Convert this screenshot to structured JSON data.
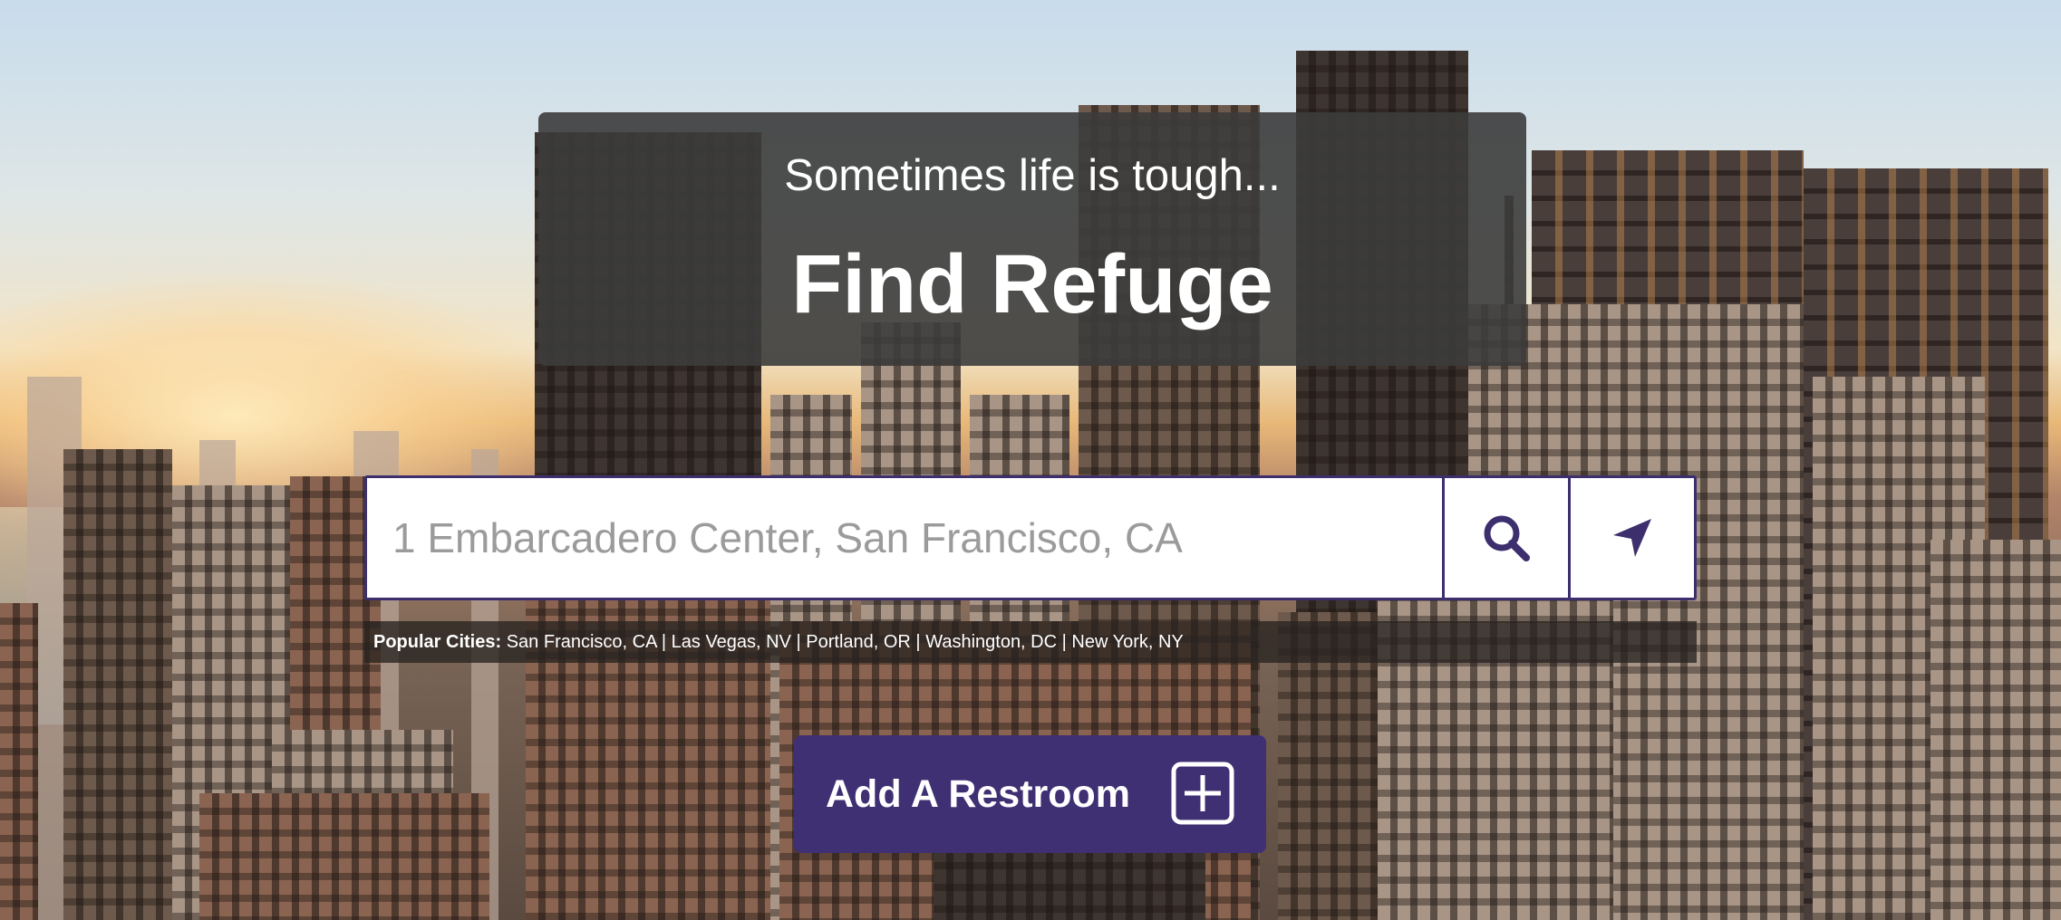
{
  "hero": {
    "subtitle": "Sometimes life is tough...",
    "title": "Find Refuge"
  },
  "search": {
    "placeholder": "1 Embarcadero Center, San Francisco, CA",
    "search_icon": "search-icon",
    "locate_icon": "location-arrow-icon"
  },
  "popular_cities": {
    "label": "Popular Cities:",
    "cities": [
      "San Francisco, CA",
      "Las Vegas, NV",
      "Portland, OR",
      "Washington, DC",
      "New York, NY"
    ],
    "separator": " | "
  },
  "add_restroom": {
    "label": "Add A Restroom",
    "icon": "plus-square-icon"
  },
  "colors": {
    "accent": "#3f2f73",
    "hero_panel": "#3c3c3c"
  }
}
